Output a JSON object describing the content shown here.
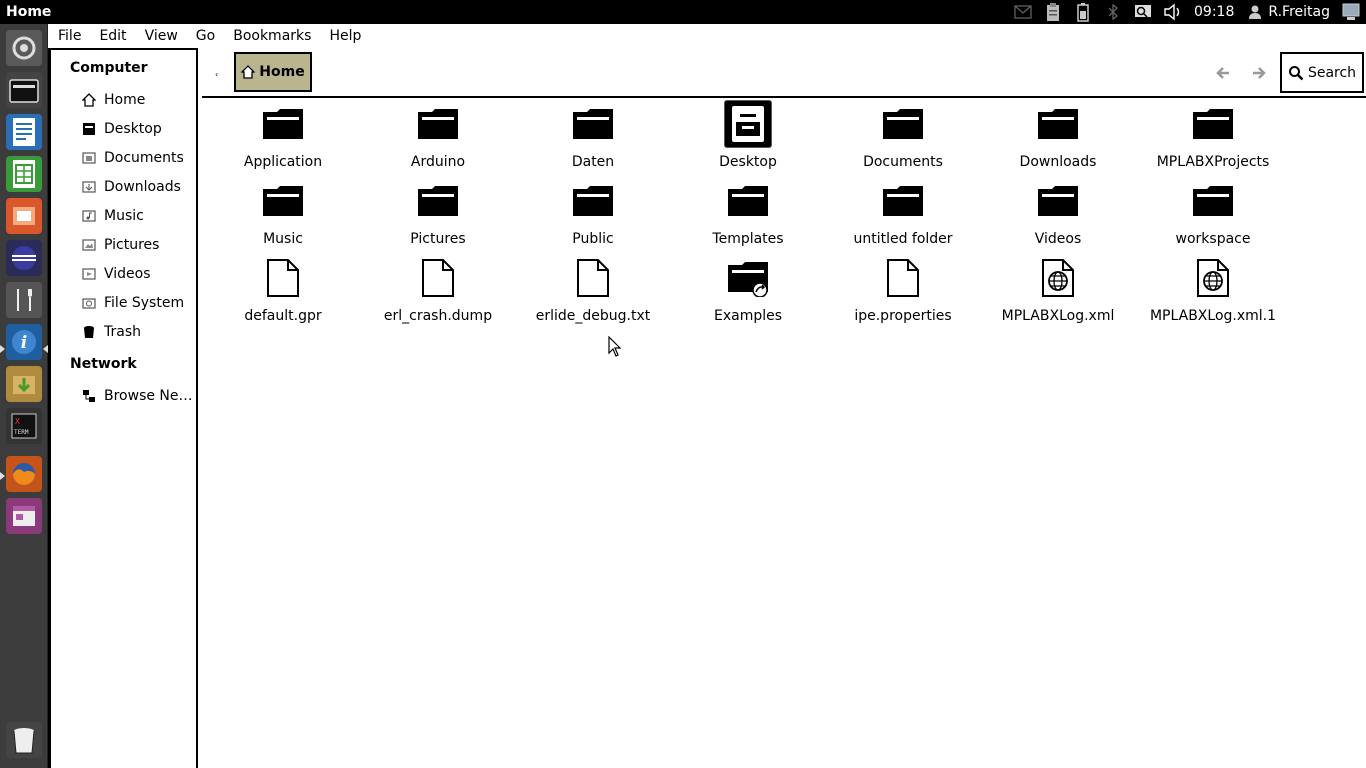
{
  "top_panel": {
    "title": "Home",
    "clock": "09:18",
    "user": "R.Freitag"
  },
  "menubar": {
    "items": [
      "File",
      "Edit",
      "View",
      "Go",
      "Bookmarks",
      "Help"
    ]
  },
  "sidebar": {
    "computer_heading": "Computer",
    "items": [
      {
        "label": "Home",
        "icon": "home-icon"
      },
      {
        "label": "Desktop",
        "icon": "desktop-icon"
      },
      {
        "label": "Documents",
        "icon": "documents-folder-icon"
      },
      {
        "label": "Downloads",
        "icon": "downloads-folder-icon"
      },
      {
        "label": "Music",
        "icon": "music-folder-icon"
      },
      {
        "label": "Pictures",
        "icon": "pictures-folder-icon"
      },
      {
        "label": "Videos",
        "icon": "videos-folder-icon"
      },
      {
        "label": "File System",
        "icon": "drive-icon"
      },
      {
        "label": "Trash",
        "icon": "trash-icon"
      }
    ],
    "network_heading": "Network",
    "network_items": [
      {
        "label": "Browse Ne…",
        "icon": "network-icon"
      }
    ]
  },
  "toolbar": {
    "breadcrumb": "Home",
    "search_label": "Search"
  },
  "files": [
    {
      "name": "Application",
      "type": "folder"
    },
    {
      "name": "Arduino",
      "type": "folder"
    },
    {
      "name": "Daten",
      "type": "folder"
    },
    {
      "name": "Desktop",
      "type": "desktop-folder"
    },
    {
      "name": "Documents",
      "type": "folder"
    },
    {
      "name": "Downloads",
      "type": "folder"
    },
    {
      "name": "MPLABXProjects",
      "type": "folder"
    },
    {
      "name": "Music",
      "type": "folder"
    },
    {
      "name": "Pictures",
      "type": "folder"
    },
    {
      "name": "Public",
      "type": "folder"
    },
    {
      "name": "Templates",
      "type": "folder"
    },
    {
      "name": "untitled folder",
      "type": "folder"
    },
    {
      "name": "Videos",
      "type": "folder"
    },
    {
      "name": "workspace",
      "type": "folder"
    },
    {
      "name": "default.gpr",
      "type": "file"
    },
    {
      "name": "erl_crash.dump",
      "type": "file"
    },
    {
      "name": "erlide_debug.txt",
      "type": "file"
    },
    {
      "name": "Examples",
      "type": "link-folder"
    },
    {
      "name": "ipe.properties",
      "type": "file"
    },
    {
      "name": "MPLABXLog.xml",
      "type": "web-file"
    },
    {
      "name": "MPLABXLog.xml.1",
      "type": "web-file"
    }
  ],
  "colors": {
    "breadcrumb_bg": "#b9b58f",
    "launcher_bg": "#3c3c3c",
    "panel_bg": "#000000"
  }
}
